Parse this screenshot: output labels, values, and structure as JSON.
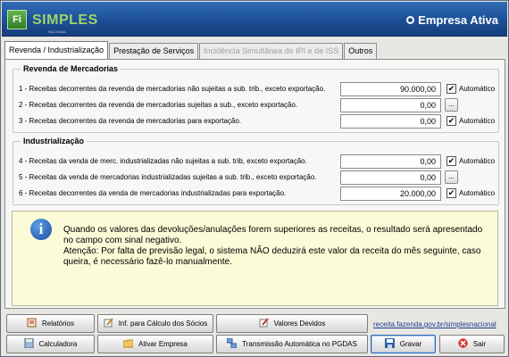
{
  "header": {
    "logo_letter": "Fi",
    "logo_text": "SIMPLES",
    "logo_subtitle": "NACIONAL",
    "status_title": "Empresa Ativa"
  },
  "tabs": [
    {
      "label": "Revenda / Industrialização",
      "state": "active"
    },
    {
      "label": "Prestação de Serviços",
      "state": "normal"
    },
    {
      "label": "Incidência Simultânea de IPI e de ISS",
      "state": "disabled"
    },
    {
      "label": "Outros",
      "state": "normal"
    }
  ],
  "revenda": {
    "title": "Revenda de Mercadorias",
    "rows": [
      {
        "label": "1 - Receitas decorrentes da revenda de mercadorias não sujeitas a sub. trib., exceto exportação.",
        "value": "90.000,00",
        "auto": true,
        "auto_label": "Automático"
      },
      {
        "label": "2 - Receitas decorrentes da revenda de mercadorias sujeitas a sub., exceto exportação.",
        "value": "0,00",
        "auto": false,
        "button": "..."
      },
      {
        "label": "3 - Receitas decorrentes da revenda de mercadorias para exportação.",
        "value": "0,00",
        "auto": true,
        "auto_label": "Automático"
      }
    ]
  },
  "industrializacao": {
    "title": "Industrialização",
    "rows": [
      {
        "label": "4 - Receitas da venda de merc. industrializadas não sujeitas a sub. trib, exceto exportação.",
        "value": "0,00",
        "auto": true,
        "auto_label": "Automático"
      },
      {
        "label": "5 - Receitas da venda de mercadorias industrializadas sujeitas a sub. trib., exceto exportação.",
        "value": "0,00",
        "auto": false,
        "button": "..."
      },
      {
        "label": "6 - Receitas decorrentes da venda de mercadorias industrializadas para exportação.",
        "value": "20.000,00",
        "auto": true,
        "auto_label": "Automático"
      }
    ]
  },
  "info": {
    "icon": "i",
    "paragraph1": "Quando os valores das devoluções/anulações forem superiores as receitas, o resultado será apresentado no campo com sinal negativo.",
    "paragraph2": "Atenção: Por falta de previsão legal, o sistema NÃO deduzirá este valor da receita do mês seguinte, caso queira, é necessário fazê-lo manualmente."
  },
  "buttons": {
    "relatorios": "Relatórios",
    "inf_calculo": "Inf. para Cálculo dos Sócios",
    "valores_devidos": "Valores Devidos",
    "calculadora": "Calculadora",
    "ativar_empresa": "Ativar Empresa",
    "transmissao": "Transmissão Automática no PGDAS",
    "gravar": "Gravar",
    "sair": "Sair"
  },
  "link": "receita.fazenda.gov.br/simplesnacional",
  "colors": {
    "header_blue": "#1c4f96",
    "info_bg": "#fbfbd7",
    "logo_green": "#9ed36a"
  }
}
